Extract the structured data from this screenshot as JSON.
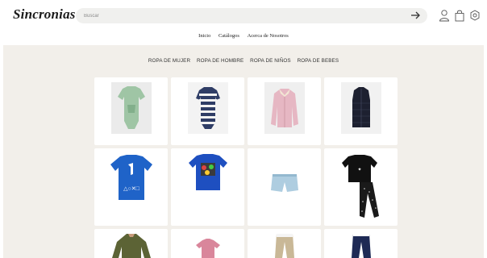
{
  "header": {
    "logo": "Sincronias",
    "search_placeholder": "Buscar",
    "icons": [
      "arrow-right-icon",
      "user-icon",
      "bag-icon",
      "settings-icon"
    ]
  },
  "nav": {
    "items": [
      "Inicio",
      "Catálogos",
      "Acerca de Nosotros"
    ]
  },
  "categories": [
    "ROPA DE MUJER",
    "ROPA DE HOMBRE",
    "ROPA DE NIÑOS",
    "ROPA DE BEBES"
  ],
  "products": [
    {
      "name": "green-baby-romper",
      "color": "#9fc5a5"
    },
    {
      "name": "striped-navy-romper",
      "color": "#2f3d66"
    },
    {
      "name": "pink-sherpa-jacket",
      "color": "#e6b7c3"
    },
    {
      "name": "black-puffer-vest",
      "color": "#1d2030"
    },
    {
      "name": "blue-playstation-tee",
      "color": "#1f63c8"
    },
    {
      "name": "blue-graphic-tee",
      "color": "#1e4fc0"
    },
    {
      "name": "light-blue-shorts",
      "color": "#aecde0"
    },
    {
      "name": "black-pajama-set",
      "color": "#111111"
    },
    {
      "name": "olive-long-sleeve",
      "color": "#5c6335"
    },
    {
      "name": "pink-tee",
      "color": "#d9869b"
    },
    {
      "name": "khaki-pants",
      "color": "#c9b897"
    },
    {
      "name": "navy-jeans",
      "color": "#1e2a55"
    }
  ]
}
